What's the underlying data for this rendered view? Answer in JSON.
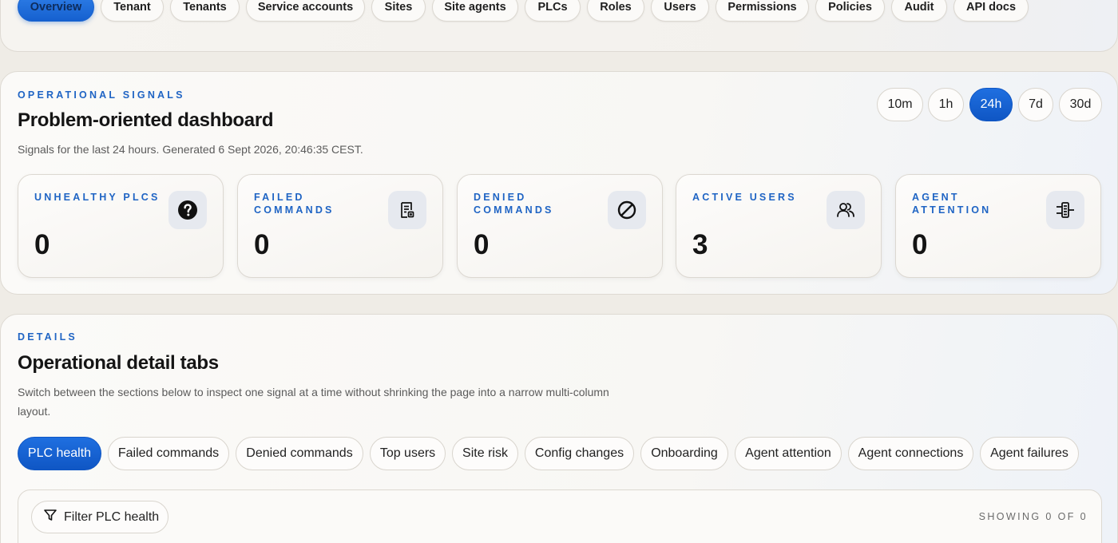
{
  "nav": {
    "items": [
      {
        "label": "Overview",
        "active": true
      },
      {
        "label": "Tenant"
      },
      {
        "label": "Tenants"
      },
      {
        "label": "Service accounts"
      },
      {
        "label": "Sites"
      },
      {
        "label": "Site agents"
      },
      {
        "label": "PLCs"
      },
      {
        "label": "Roles"
      },
      {
        "label": "Users"
      },
      {
        "label": "Permissions"
      },
      {
        "label": "Policies"
      },
      {
        "label": "Audit"
      },
      {
        "label": "API docs"
      }
    ]
  },
  "signals": {
    "eyebrow": "OPERATIONAL SIGNALS",
    "title": "Problem-oriented dashboard",
    "subtitle": "Signals for the last 24 hours. Generated 6 Sept 2026, 20:46:35 CEST.",
    "ranges": [
      "10m",
      "1h",
      "24h",
      "7d",
      "30d"
    ],
    "active_range": "24h",
    "metrics": [
      {
        "label": "UNHEALTHY PLCS",
        "value": "0",
        "icon": "question-circle-icon"
      },
      {
        "label": "FAILED COMMANDS",
        "value": "0",
        "icon": "failed-document-icon"
      },
      {
        "label": "DENIED COMMANDS",
        "value": "0",
        "icon": "ban-icon"
      },
      {
        "label": "ACTIVE USERS",
        "value": "3",
        "icon": "users-icon"
      },
      {
        "label": "AGENT ATTENTION",
        "value": "0",
        "icon": "agent-network-icon"
      }
    ]
  },
  "details": {
    "eyebrow": "DETAILS",
    "title": "Operational detail tabs",
    "subtitle_line1": "Switch between the sections below to inspect one signal at a time without shrinking the page into a narrow multi-column",
    "subtitle_line2": "layout.",
    "tabs": [
      {
        "label": "PLC health",
        "active": true
      },
      {
        "label": "Failed commands"
      },
      {
        "label": "Denied commands"
      },
      {
        "label": "Top users"
      },
      {
        "label": "Site risk"
      },
      {
        "label": "Config changes"
      },
      {
        "label": "Onboarding"
      },
      {
        "label": "Agent attention"
      },
      {
        "label": "Agent connections"
      },
      {
        "label": "Agent failures"
      }
    ],
    "filter_label": "Filter PLC health",
    "showing": "SHOWING 0 OF 0"
  },
  "colors": {
    "accent": "#1560cf",
    "eyebrow": "#1f64c4",
    "background": "#efece6"
  }
}
